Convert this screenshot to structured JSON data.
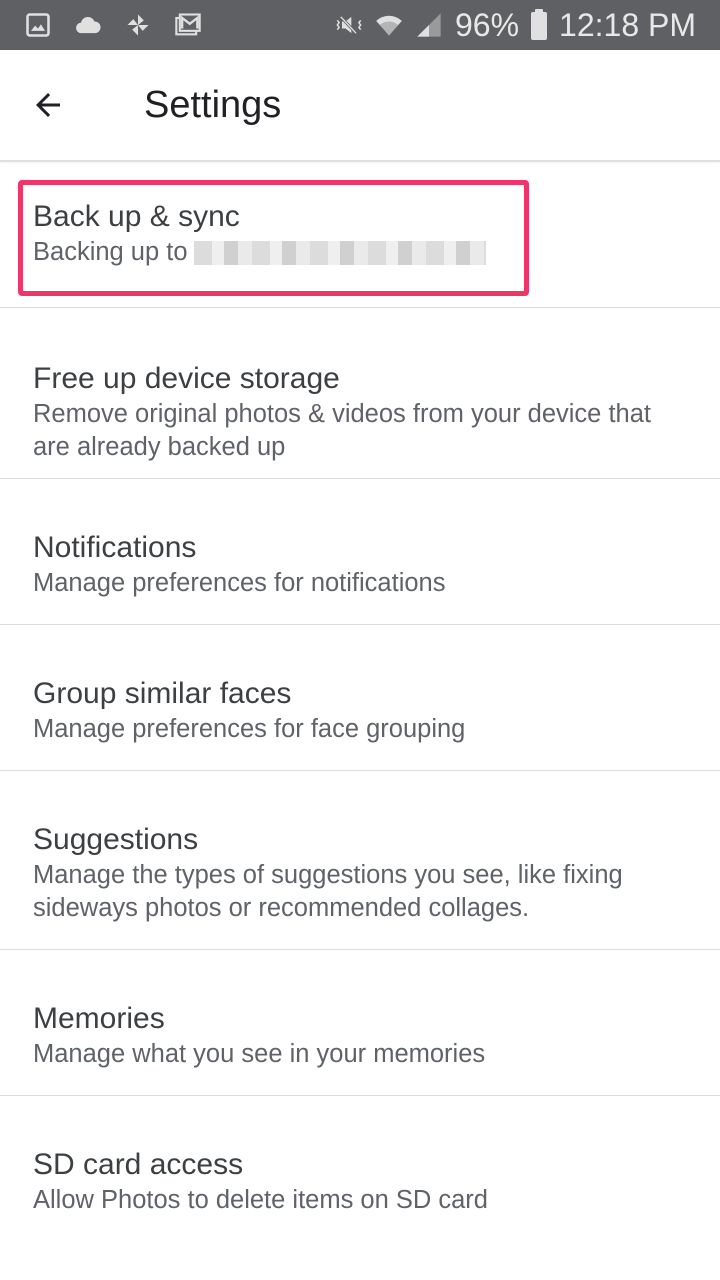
{
  "status_bar": {
    "left_icons": [
      "gallery-icon",
      "cloud-icon",
      "pinwheel-icon",
      "gmail-icon"
    ],
    "right_icons": [
      "vibrate-mute-icon",
      "wifi-icon",
      "cellular-signal-icon"
    ],
    "battery_percent": "96%",
    "time": "12:18 PM"
  },
  "app_bar": {
    "back_icon": "arrow-back-icon",
    "title": "Settings"
  },
  "settings": {
    "items": [
      {
        "title": "Back up & sync",
        "subtitle": "Backing up to",
        "subtitle_account": "[blurred account]",
        "highlighted": true
      },
      {
        "title": "Free up device storage",
        "subtitle": "Remove original photos & videos from your device that are already backed up"
      },
      {
        "title": "Notifications",
        "subtitle": "Manage preferences for notifications"
      },
      {
        "title": "Group similar faces",
        "subtitle": "Manage preferences for face grouping"
      },
      {
        "title": "Suggestions",
        "subtitle": "Manage the types of suggestions you see, like fixing sideways photos or recommended collages."
      },
      {
        "title": "Memories",
        "subtitle": "Manage what you see in your memories"
      },
      {
        "title": "SD card access",
        "subtitle": "Allow Photos to delete items on SD card"
      }
    ]
  },
  "colors": {
    "status_bar_bg": "#5f6063",
    "highlight": "#f0356b",
    "title_text": "#3c4043",
    "subtitle_text": "#5f6368",
    "divider": "#dadce0"
  }
}
